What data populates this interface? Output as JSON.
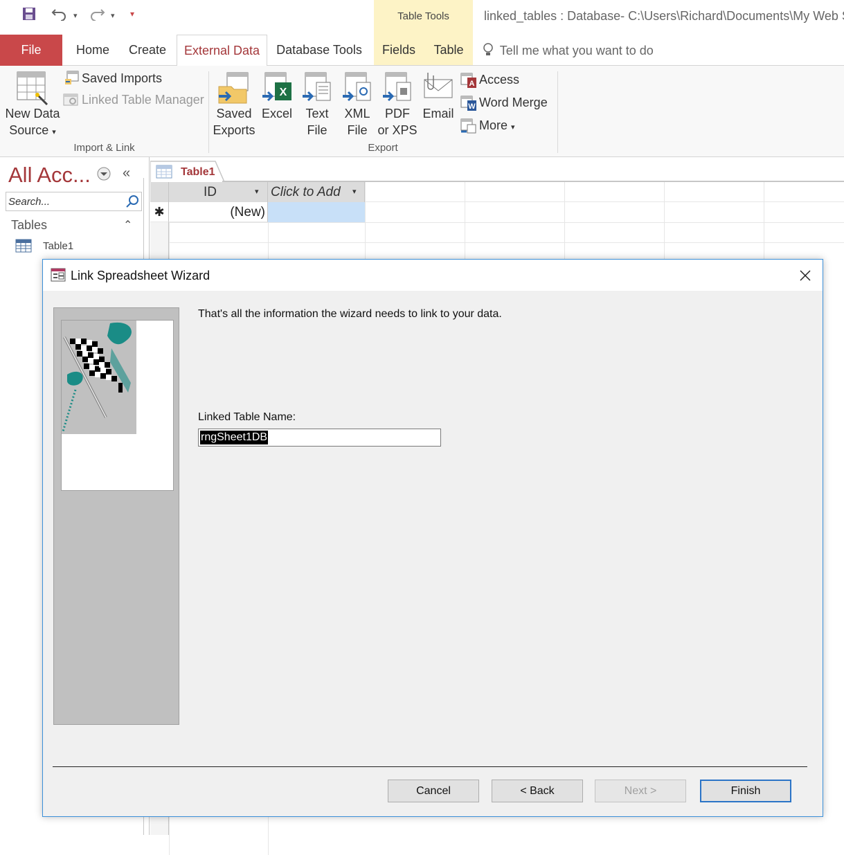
{
  "window": {
    "title": "linked_tables : Database- C:\\Users\\Richard\\Documents\\My Web Si",
    "context_tab_group": "Table Tools"
  },
  "tabs": [
    {
      "label": "File"
    },
    {
      "label": "Home"
    },
    {
      "label": "Create"
    },
    {
      "label": "External Data"
    },
    {
      "label": "Database Tools"
    },
    {
      "label": "Fields"
    },
    {
      "label": "Table"
    }
  ],
  "tell_me": "Tell me what you want to do",
  "ribbon": {
    "import_link": {
      "new_data_source": "New Data\nSource ▾",
      "new_data_source_line1": "New Data",
      "new_data_source_line2": "Source",
      "saved_imports": "Saved Imports",
      "linked_table_manager": "Linked Table Manager",
      "group_label": "Import & Link"
    },
    "export": {
      "saved_exports_1": "Saved",
      "saved_exports_2": "Exports",
      "excel": "Excel",
      "text_file_1": "Text",
      "text_file_2": "File",
      "xml_file_1": "XML",
      "xml_file_2": "File",
      "pdf_1": "PDF",
      "pdf_2": "or XPS",
      "email": "Email",
      "access": "Access",
      "word_merge": "Word Merge",
      "more": "More",
      "group_label": "Export"
    }
  },
  "nav": {
    "title": "All Acc...",
    "search_placeholder": "Search...",
    "section": "Tables",
    "items": [
      {
        "label": "Table1"
      }
    ]
  },
  "document": {
    "tab_label": "Table1",
    "columns": [
      {
        "label": "ID"
      },
      {
        "label": "Click to Add"
      }
    ],
    "new_row_marker": "✱",
    "new_row_value": "(New)"
  },
  "dialog": {
    "title": "Link Spreadsheet Wizard",
    "message": "That's all the information the wizard needs to link to your data.",
    "field_label": "Linked Table Name:",
    "field_value": "rngSheet1DB",
    "buttons": {
      "cancel": "Cancel",
      "back": "< Back",
      "next": "Next >",
      "finish": "Finish"
    }
  },
  "colors": {
    "accent": "#a4373a",
    "file_tab": "#c9484a",
    "context_band": "#fdf3c6",
    "dialog_border": "#3b8fd9"
  }
}
